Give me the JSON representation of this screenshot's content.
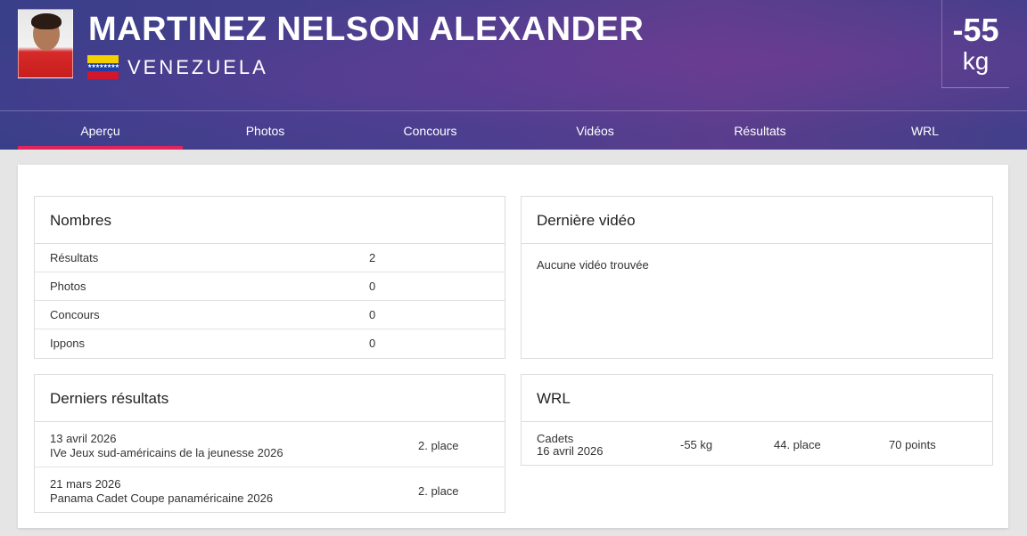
{
  "athlete": {
    "name": "MARTINEZ NELSON ALEXANDER",
    "country": "VENEZUELA",
    "weight_value": "-55",
    "weight_unit": "kg"
  },
  "tabs": [
    {
      "label": "Aperçu",
      "active": true
    },
    {
      "label": "Photos",
      "active": false
    },
    {
      "label": "Concours",
      "active": false
    },
    {
      "label": "Vidéos",
      "active": false
    },
    {
      "label": "Résultats",
      "active": false
    },
    {
      "label": "WRL",
      "active": false
    }
  ],
  "numbers": {
    "title": "Nombres",
    "rows": [
      {
        "label": "Résultats",
        "value": "2"
      },
      {
        "label": "Photos",
        "value": "0"
      },
      {
        "label": "Concours",
        "value": "0"
      },
      {
        "label": "Ippons",
        "value": "0"
      }
    ]
  },
  "last_video": {
    "title": "Dernière vidéo",
    "empty_text": "Aucune vidéo trouvée"
  },
  "last_results": {
    "title": "Derniers résultats",
    "rows": [
      {
        "date": "13 avril 2026",
        "event": "IVe Jeux sud-américains de la jeunesse 2026",
        "place": "2. place"
      },
      {
        "date": "21 mars 2026",
        "event": "Panama Cadet Coupe panaméricaine 2026",
        "place": "2. place"
      }
    ]
  },
  "wrl": {
    "title": "WRL",
    "rows": [
      {
        "category": "Cadets",
        "date": "16 avril 2026",
        "weight": "-55 kg",
        "place": "44. place",
        "points": "70 points"
      }
    ]
  },
  "colors": {
    "accent": "#e0245e",
    "header_dark": "#3a3f8a"
  }
}
